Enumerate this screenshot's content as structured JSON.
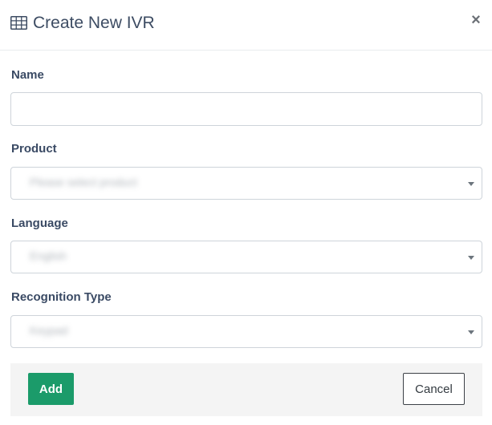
{
  "modal": {
    "title": "Create New IVR",
    "title_icon": "table-icon",
    "close_label": "×"
  },
  "form": {
    "name": {
      "label": "Name",
      "value": "",
      "placeholder": ""
    },
    "product": {
      "label": "Product",
      "value": "Please select product"
    },
    "language": {
      "label": "Language",
      "value": "English"
    },
    "recognition_type": {
      "label": "Recognition Type",
      "value": "Keypad"
    }
  },
  "footer": {
    "add_label": "Add",
    "cancel_label": "Cancel"
  },
  "colors": {
    "primary": "#1b9b6a",
    "title_text": "#3d4c63",
    "label_text": "#3a4a64",
    "footer_bg": "#f4f4f4"
  }
}
